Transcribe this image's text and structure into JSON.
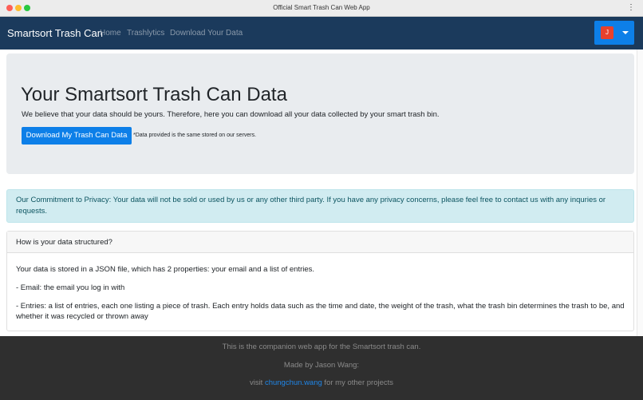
{
  "window": {
    "title": "Official Smart Trash Can Web App"
  },
  "navbar": {
    "brand": "Smartsort Trash Can",
    "links": [
      "Home",
      "Trashlytics",
      "Download Your Data"
    ],
    "user_initial": "J"
  },
  "jumbotron": {
    "heading": "Your Smartsort Trash Can Data",
    "lead": "We believe that your data should be yours. Therefore, here you can download all your data collected by your smart trash bin.",
    "button_label": "Download My Trash Can Data",
    "note": "*Data provided is the same stored on our servers."
  },
  "privacy": {
    "text": "Our Commitment to Privacy: Your data will not be sold or used by us or any other third party. If you have any privacy concerns, please feel free to contact us with any inquries or requests."
  },
  "card": {
    "header": "How is your data structured?",
    "paragraphs": [
      "Your data is stored in a JSON file, which has 2 properties: your email and a list of entries.",
      "- Email: the email you log in with",
      "- Entries: a list of entries, each one listing a piece of trash. Each entry holds data such as the time and date, the weight of the trash, what the trash bin determines the trash to be, and whether it was recycled or thrown away"
    ]
  },
  "footer": {
    "line1": "This is the companion web app for the Smartsort trash can.",
    "line2": "Made by Jason Wang:",
    "line3_prefix": "visit ",
    "line3_link": "chungchun.wang",
    "line3_suffix": " for my other projects"
  },
  "colors": {
    "navbar": "#1b3a5c",
    "primary_button": "#0d7fe8",
    "avatar": "#e8412c",
    "jumbotron_bg": "#e9ecef",
    "alert_bg": "#d1ecf1",
    "alert_text": "#0c5460",
    "footer_bg": "#2f2f2f",
    "footer_link": "#1f86e8"
  }
}
